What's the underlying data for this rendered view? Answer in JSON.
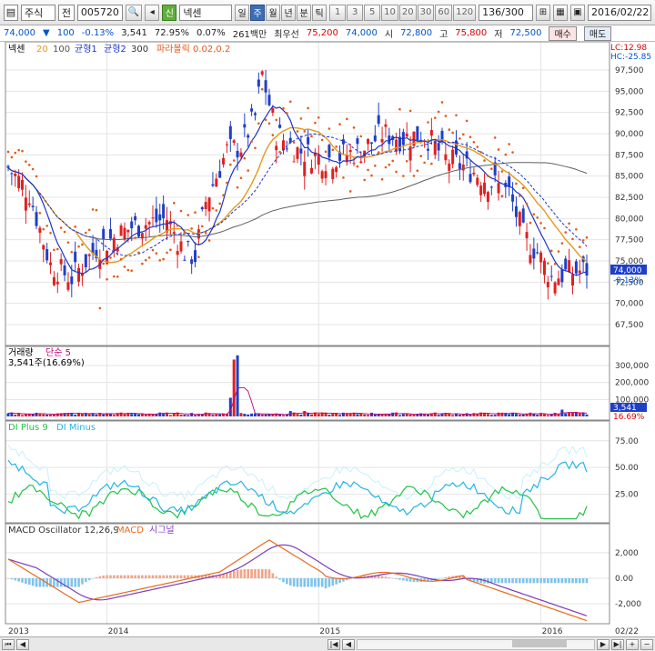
{
  "toolbar": {
    "market": "주식",
    "prefix": "전",
    "code": "005720",
    "name_tag": "신",
    "name": "넥센",
    "periods": [
      "일",
      "주",
      "월",
      "년",
      "분",
      "틱"
    ],
    "active_period": "주",
    "intervals": [
      "1",
      "3",
      "5",
      "10",
      "20",
      "30",
      "60",
      "120"
    ],
    "count": "136",
    "count_total": "/300",
    "date": "2016/02/22"
  },
  "infobar": {
    "price": "74,000",
    "change": "100",
    "change_pct": "-0.13%",
    "volume": "3,541",
    "vol_ratio": "72.95%",
    "turnover": "0.07%",
    "amount": "261백만",
    "low_label": "최우선",
    "best1": "75,200",
    "best2": "74,000",
    "open_label": "시",
    "open": "72,800",
    "high_label": "고",
    "high": "75,800",
    "low_label2": "저",
    "low": "72,500",
    "buy": "매수",
    "sell": "매도"
  },
  "price_panel": {
    "title": "넥센",
    "ma_labels": [
      "20",
      "100"
    ],
    "ind1": "균형1",
    "ind2": "균형2",
    "ind2_val": "300",
    "sar": "파라볼릭 0.02,0.2",
    "lc": "LC:12.98",
    "hc": "HC:-25.85",
    "axis": [
      "97,500",
      "95,000",
      "92,500",
      "90,000",
      "87,500",
      "85,000",
      "82,500",
      "80,000",
      "77,500",
      "75,000",
      "72,500",
      "70,000",
      "67,500"
    ],
    "cur_price": "74,000",
    "cur_pct": "-0.13%"
  },
  "volume_panel": {
    "title": "거래량",
    "sub": "단순 5",
    "value": "3,541주(16.69%)",
    "axis": [
      "300,000",
      "200,000",
      "100,000"
    ],
    "cur_value": "3,541",
    "cur_pct": "16.69%"
  },
  "dmi_panel": {
    "plus": "DI Plus 9",
    "minus": "DI Minus",
    "axis": [
      "75.00",
      "50.00",
      "25.00"
    ]
  },
  "macd_panel": {
    "osc": "MACD Oscillator 12,26,9",
    "macd": "MACD",
    "signal": "시그널",
    "axis": [
      "2,000",
      "0.00",
      "-2,000"
    ]
  },
  "xaxis": {
    "labels": [
      "2013",
      "2014",
      "2015",
      "2016",
      "02/22"
    ]
  },
  "colors": {
    "up": "#e02020",
    "down": "#1f3fc8",
    "ma20": "#e49a1c",
    "ma100": "#606060",
    "sar": "#e25a18",
    "ichimoku": "#1e34c8",
    "diplus": "#21c445",
    "diminus": "#25b5e6",
    "macd": "#e86a1e",
    "signal": "#7a3dbf"
  }
}
